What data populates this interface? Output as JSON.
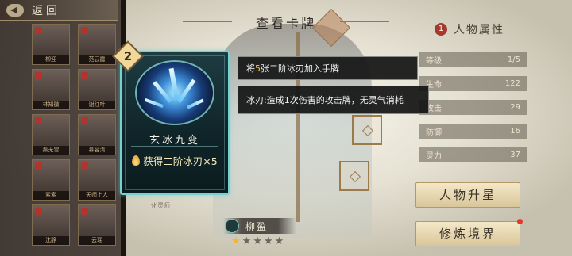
{
  "header": {
    "back_label": "返回",
    "title": "查看卡牌"
  },
  "roster": [
    {
      "name": "柳迎"
    },
    {
      "name": "范云霞"
    },
    {
      "name": "林知微"
    },
    {
      "name": "谢红叶"
    },
    {
      "name": "秦无雪"
    },
    {
      "name": "慕容清"
    },
    {
      "name": "素素"
    },
    {
      "name": "天师上人"
    },
    {
      "name": "沈静"
    },
    {
      "name": "云瑶"
    }
  ],
  "card": {
    "cost": "2",
    "name": "玄冰九变",
    "effect": "获得二阶冰刃×5",
    "caption": "化灵师"
  },
  "tooltip_primary": {
    "prefix": "将",
    "highlight": "5",
    "suffix": "张二阶冰刃加入手牌"
  },
  "tooltip_secondary": "冰刃:造成1次伤害的攻击牌，无灵气消耗",
  "attributes": {
    "title": "人物属性",
    "icon_text": "1",
    "rows": [
      {
        "label": "等级",
        "value": "1/5"
      },
      {
        "label": "生命",
        "value": "122"
      },
      {
        "label": "攻击",
        "value": "29"
      },
      {
        "label": "防御",
        "value": "16"
      },
      {
        "label": "灵力",
        "value": "37"
      }
    ]
  },
  "buttons": {
    "upgrade": "人物升星",
    "cultivate": "修炼境界"
  },
  "character": {
    "name": "柳盈",
    "stars_filled": 1,
    "stars_total": 5
  },
  "colors": {
    "card_border": "#74d3d2",
    "highlight": "#f6c443",
    "star": "#f2b632"
  }
}
